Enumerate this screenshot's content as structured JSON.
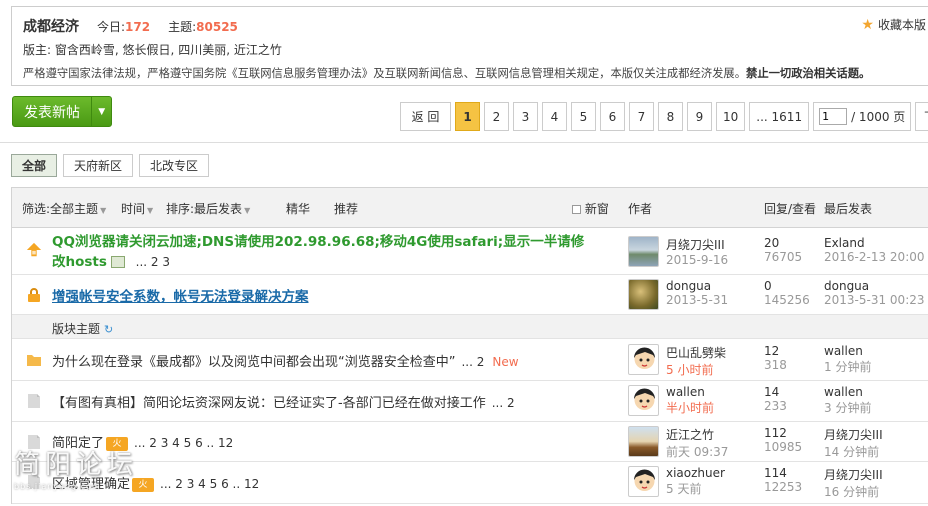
{
  "forum": {
    "name": "成都经济",
    "today_label": "今日:",
    "today_value": "172",
    "topics_label": "主题:",
    "topics_value": "80525",
    "favorite_label": "收藏本版",
    "moderators_label": "版主:",
    "moderators": [
      "窗含西岭雪",
      "悠长假日",
      "四川美丽",
      "近江之竹"
    ],
    "rules_text": "严格遵守国家法律法规，严格遵守国务院《互联网信息服务管理办法》及互联网新闻信息、互联网信息管理相关规定，本版仅关注成都经济发展。",
    "rules_bold": "禁止一切政治相关话题。"
  },
  "toolbar": {
    "post_label": "发表新帖"
  },
  "pager": {
    "back_label": "返 回",
    "pages": [
      "1",
      "2",
      "3",
      "4",
      "5",
      "6",
      "7",
      "8",
      "9",
      "10"
    ],
    "current": "1",
    "last_label": "... 1611",
    "jump_value": "1",
    "total_label": "/ 1000 页",
    "next_label": "下"
  },
  "tabs": [
    {
      "label": "全部",
      "active": true
    },
    {
      "label": "天府新区",
      "active": false
    },
    {
      "label": "北改专区",
      "active": false
    }
  ],
  "filter_bar": {
    "filter_label": "筛选:",
    "filter_value": "全部主题",
    "time_label": "时间",
    "sort_label": "排序:",
    "sort_value": "最后发表",
    "digest_label": "精华",
    "recommend_label": "推荐",
    "newwin_label": "新窗",
    "author_header": "作者",
    "counts_header": "回复/查看",
    "last_header": "最后发表"
  },
  "section_label": "版块主题",
  "threads": [
    {
      "title_line1": "QQ浏览器请关闭云加速;DNS请使用202.98.96.68;移动4G使用safari;显示一半请修",
      "title_line2": "改hosts",
      "pages": "... 2  3",
      "author": "月绕刀尖III",
      "author_date": "2015-9-16",
      "replies": "20",
      "views": "76705",
      "last_user": "Exland",
      "last_time": "2016-2-13 20:00"
    },
    {
      "title": "增强帐号安全系数，帐号无法登录解决方案",
      "author": "dongua",
      "author_date": "2013-5-31",
      "replies": "0",
      "views": "145256",
      "last_user": "dongua",
      "last_time": "2013-5-31 00:23"
    },
    {
      "title": "为什么现在登录《最成都》以及阅览中间都会出现“浏览器安全检查中”",
      "pages": "... 2",
      "new_label": "New",
      "author": "巴山乱劈柴",
      "author_date": "5 小时前",
      "replies": "12",
      "views": "318",
      "last_user": "wallen",
      "last_time": "1 分钟前"
    },
    {
      "title": "【有图有真相】简阳论坛资深网友说：已经证实了-各部门已经在做对接工作",
      "pages": "... 2",
      "author": "wallen",
      "author_date": "半小时前",
      "replies": "14",
      "views": "233",
      "last_user": "wallen",
      "last_time": "3 分钟前"
    },
    {
      "title": "简阳定了",
      "hot_label": "火",
      "pages": "... 2  3  4  5  6 .. 12",
      "author": "近江之竹",
      "author_date": "前天 09:37",
      "replies": "112",
      "views": "10985",
      "last_user": "月绕刀尖III",
      "last_time": "14 分钟前"
    },
    {
      "title": "区域管理确定",
      "hot_label": "火",
      "pages": "... 2  3  4  5  6 .. 12",
      "author": "xiaozhuer",
      "author_date": "5 天前",
      "replies": "114",
      "views": "12253",
      "last_user": "月绕刀尖III",
      "last_time": "16 分钟前"
    }
  ],
  "watermark": {
    "text": "简阳论坛",
    "sub": "bbs.jianyang.com"
  },
  "colors": {
    "accent_green": "#4a9a14",
    "sticky_title": "#2f9a2f",
    "link_blue": "#1a6aa8",
    "hot_orange": "#f26c4f",
    "page_current": "#f5c343"
  }
}
